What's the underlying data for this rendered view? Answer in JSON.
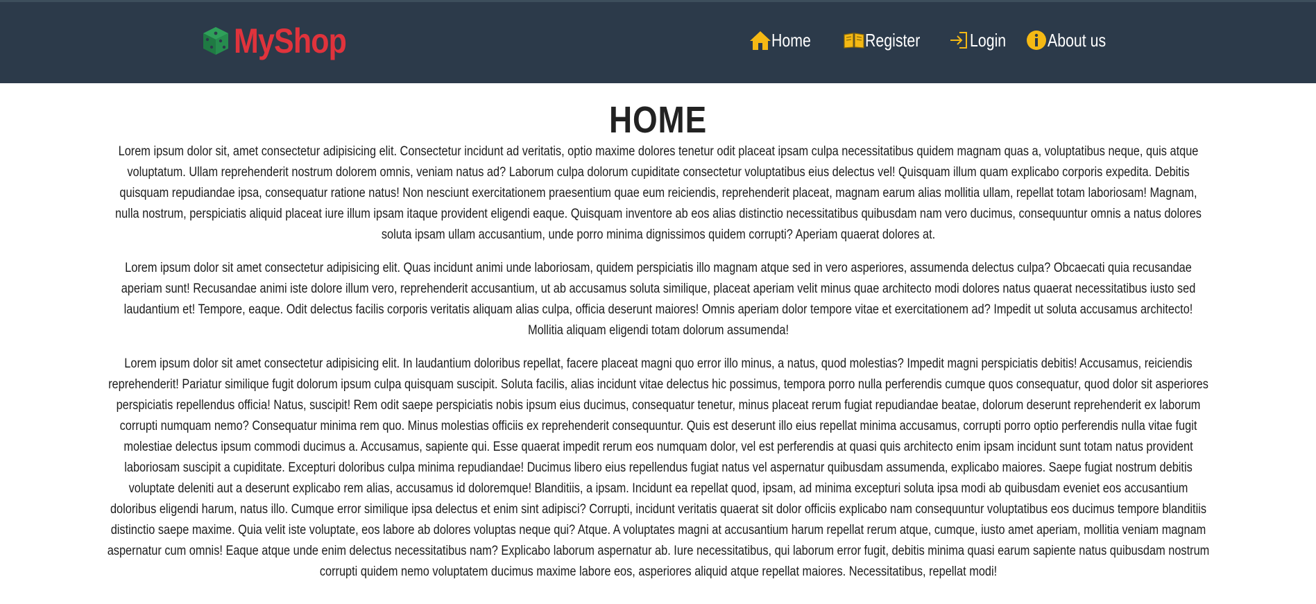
{
  "header": {
    "brand_name": "MyShop",
    "brand_color": "#e0333c",
    "background_color": "#2c3a4a",
    "nav": [
      {
        "label": "Home",
        "icon": "home-icon"
      },
      {
        "label": "Register",
        "icon": "book-icon"
      },
      {
        "label": "Login",
        "icon": "login-icon"
      },
      {
        "label": "About us",
        "icon": "info-icon"
      }
    ]
  },
  "main": {
    "title": "HOME",
    "paragraphs": [
      "Lorem ipsum dolor sit, amet consectetur adipisicing elit. Consectetur incidunt ad veritatis, optio maxime dolores tenetur odit placeat ipsam culpa necessitatibus quidem magnam quas a, voluptatibus neque, quis atque voluptatum. Ullam reprehenderit nostrum dolorem omnis, veniam natus ad? Laborum culpa dolorum cupiditate consectetur voluptatibus eius delectus vel! Quisquam illum quam explicabo corporis expedita. Debitis quisquam repudiandae ipsa, consequatur ratione natus! Non nesciunt exercitationem praesentium quae eum reiciendis, reprehenderit placeat, magnam earum alias mollitia ullam, repellat totam laboriosam! Magnam, nulla nostrum, perspiciatis aliquid placeat iure illum ipsam itaque provident eligendi eaque. Quisquam inventore ab eos alias distinctio necessitatibus quibusdam nam vero ducimus, consequuntur omnis a natus dolores soluta ipsam ullam accusantium, unde porro minima dignissimos quidem corrupti? Aperiam quaerat dolores at.",
      "Lorem ipsum dolor sit amet consectetur adipisicing elit. Quas incidunt animi unde laboriosam, quidem perspiciatis illo magnam atque sed in vero asperiores, assumenda delectus culpa? Obcaecati quia recusandae aperiam sunt! Recusandae animi iste dolore illum vero, reprehenderit accusantium, ut ab accusamus soluta similique, placeat aperiam velit minus quae architecto modi dolores natus quaerat necessitatibus iusto sed laudantium et! Tempore, eaque. Odit delectus facilis corporis veritatis aliquam alias culpa, officia deserunt maiores! Omnis aperiam dolor tempore vitae et exercitationem ad? Impedit ut soluta accusamus architecto! Mollitia aliquam eligendi totam dolorum assumenda!",
      "Lorem ipsum dolor sit amet consectetur adipisicing elit. In laudantium doloribus repellat, facere placeat magni quo error illo minus, a natus, quod molestias? Impedit magni perspiciatis debitis! Accusamus, reiciendis reprehenderit! Pariatur similique fugit dolorum ipsum culpa quisquam suscipit. Soluta facilis, alias incidunt vitae delectus hic possimus, tempora porro nulla perferendis cumque quos consequatur, quod dolor sit asperiores perspiciatis repellendus officia! Natus, suscipit! Rem odit saepe perspiciatis nobis ipsum eius ducimus, consequatur tenetur, minus placeat rerum fugiat repudiandae beatae, dolorum deserunt reprehenderit ex laborum corrupti numquam nemo? Consequatur minima rem quo. Minus molestias officiis ex reprehenderit consequuntur. Quis est deserunt illo eius repellat minima accusamus, corrupti porro optio perferendis nulla vitae fugit molestiae delectus ipsum commodi ducimus a. Accusamus, sapiente qui. Esse quaerat impedit rerum eos numquam dolor, vel est perferendis at quasi quis architecto enim ipsam incidunt sunt totam natus provident laboriosam suscipit a cupiditate. Excepturi doloribus culpa minima repudiandae! Ducimus libero eius repellendus fugiat natus vel aspernatur quibusdam assumenda, explicabo maiores. Saepe fugiat nostrum debitis voluptate deleniti aut a deserunt explicabo rem alias, accusamus id doloremque! Blanditiis, a ipsam. Incidunt ea repellat quod, ipsam, ad minima excepturi soluta ipsa modi ab quibusdam eveniet eos accusantium doloribus eligendi harum, natus illo. Cumque error similique ipsa delectus et enim sint adipisci? Corrupti, incidunt veritatis quaerat sit dolor officiis explicabo nam consequuntur voluptatibus eos ducimus tempore blanditiis distinctio saepe maxime. Quia velit iste voluptate, eos labore ab dolores voluptas neque qui? Atque. A voluptates magni at accusantium harum repellat rerum atque, cumque, iusto amet aperiam, mollitia veniam magnam aspernatur cum omnis! Eaque atque unde enim delectus necessitatibus nam? Explicabo laborum aspernatur ab. Iure necessitatibus, qui laborum error fugit, debitis minima quasi earum sapiente natus quibusdam nostrum corrupti quidem nemo voluptatem ducimus maxime labore eos, asperiores aliquid atque repellat maiores. Necessitatibus, repellat modi!"
    ]
  }
}
